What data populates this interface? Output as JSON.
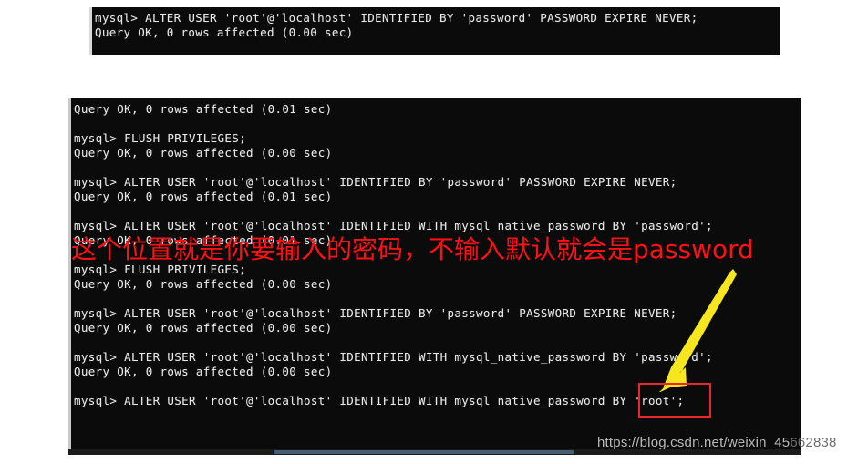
{
  "page": {
    "background": "#ffffff",
    "terminal_bg": "#0b0b0b",
    "terminal_fg": "#e8e8e8",
    "accent_red": "#ff0f16",
    "accent_yellow": "#f5e620",
    "box_red": "#e8262c"
  },
  "terminal_top": {
    "name": "mysql-console-top",
    "lines": [
      "mysql> ALTER USER 'root'@'localhost' IDENTIFIED BY 'password' PASSWORD EXPIRE NEVER;",
      "Query OK, 0 rows affected (0.00 sec)"
    ]
  },
  "terminal_main": {
    "name": "mysql-console-main",
    "lines": [
      "Query OK, 0 rows affected (0.01 sec)",
      "",
      "mysql> FLUSH PRIVILEGES;",
      "Query OK, 0 rows affected (0.00 sec)",
      "",
      "mysql> ALTER USER 'root'@'localhost' IDENTIFIED BY 'password' PASSWORD EXPIRE NEVER;",
      "Query OK, 0 rows affected (0.01 sec)",
      "",
      "mysql> ALTER USER 'root'@'localhost' IDENTIFIED WITH mysql_native_password BY 'password';",
      "Query OK, 0 rows affected (0.01 sec)",
      "",
      "mysql> FLUSH PRIVILEGES;",
      "Query OK, 0 rows affected (0.00 sec)",
      "",
      "mysql> ALTER USER 'root'@'localhost' IDENTIFIED BY 'password' PASSWORD EXPIRE NEVER;",
      "Query OK, 0 rows affected (0.00 sec)",
      "",
      "mysql> ALTER USER 'root'@'localhost' IDENTIFIED WITH mysql_native_password BY 'password';",
      "Query OK, 0 rows affected (0.00 sec)",
      "",
      "mysql> ALTER USER 'root'@'localhost' IDENTIFIED WITH mysql_native_password BY 'root';"
    ]
  },
  "annotation": {
    "red_text": "这个位置就是你要输入的密码，不输入默认就会是password",
    "arrow_name": "yellow-arrow",
    "highlight_name": "red-highlight-box",
    "highlight_target": "'root'"
  },
  "watermark": {
    "visible_text": "https://blog.csdn.net/weixin_45",
    "dim_text": "662838"
  }
}
